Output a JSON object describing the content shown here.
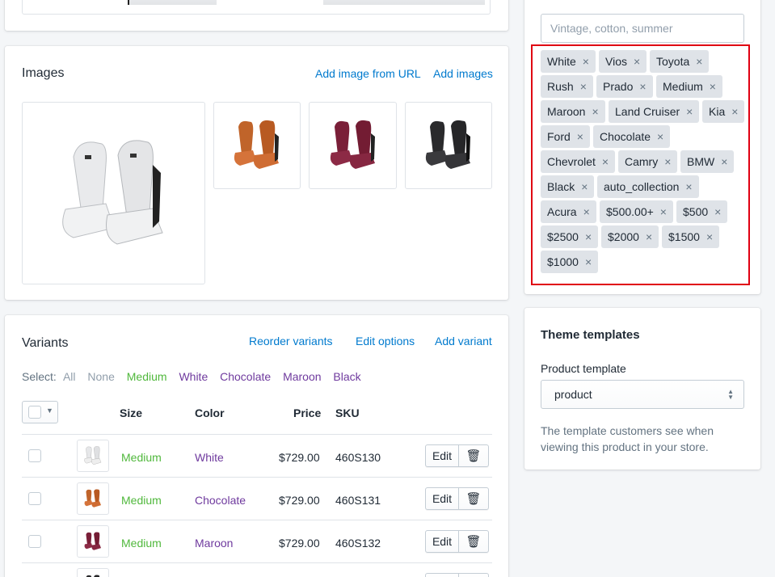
{
  "images": {
    "title": "Images",
    "add_from_url": "Add image from URL",
    "add_images": "Add images"
  },
  "variants": {
    "title": "Variants",
    "reorder": "Reorder variants",
    "edit_options": "Edit options",
    "add_variant": "Add variant",
    "select_label": "Select:",
    "select_options": [
      "All",
      "None",
      "Medium",
      "White",
      "Chocolate",
      "Maroon",
      "Black"
    ],
    "columns": [
      "Size",
      "Color",
      "Price",
      "SKU"
    ],
    "rows": [
      {
        "size": "Medium",
        "color": "White",
        "price": "$729.00",
        "sku": "460S130",
        "edit": "Edit"
      },
      {
        "size": "Medium",
        "color": "Chocolate",
        "price": "$729.00",
        "sku": "460S131",
        "edit": "Edit"
      },
      {
        "size": "Medium",
        "color": "Maroon",
        "price": "$729.00",
        "sku": "460S132",
        "edit": "Edit"
      }
    ]
  },
  "tags": {
    "placeholder": "Vintage, cotton, summer",
    "items": [
      "White",
      "Vios",
      "Toyota",
      "Rush",
      "Prado",
      "Medium",
      "Maroon",
      "Land Cruiser",
      "Kia",
      "Ford",
      "Chocolate",
      "Chevrolet",
      "Camry",
      "BMW",
      "Black",
      "auto_collection",
      "Acura",
      "$500.00+",
      "$500",
      "$2500",
      "$2000",
      "$1500",
      "$1000"
    ],
    "remove_glyph": "×"
  },
  "theme": {
    "title": "Theme templates",
    "label": "Product template",
    "selected": "product",
    "help": "The template customers see when viewing this product in your store."
  },
  "colors": {
    "link": "#007ace",
    "highlight": "#e00012",
    "tag_bg": "#dfe3e8",
    "size_green": "#50b83c",
    "color_purple": "#5c6ac4"
  }
}
